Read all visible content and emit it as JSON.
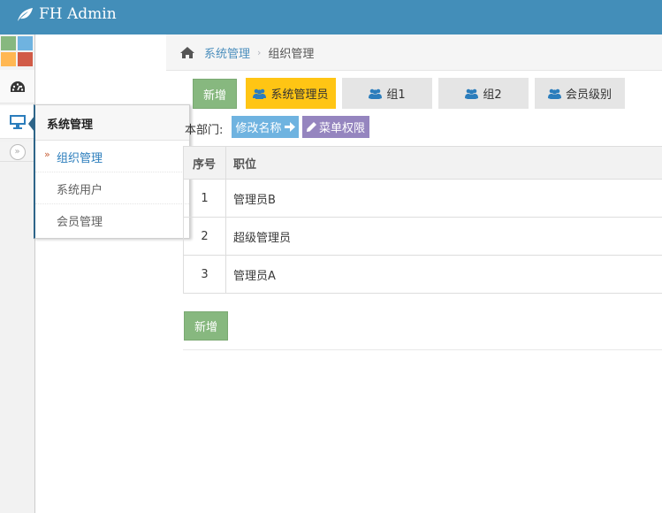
{
  "app": {
    "brand": "FH Admin"
  },
  "colors": {
    "navbar": "#438eb9",
    "accent": "#2b7dbc",
    "new_button": "#87b87f",
    "selected_group": "#ffc514",
    "rename_button": "#6fb3e0",
    "perm_button": "#9585bf"
  },
  "sidebar": {
    "shortcut_colors": [
      "#87b87f",
      "#6fb3e0",
      "#ffb752",
      "#d15b47"
    ],
    "icons": [
      "dashboard-icon",
      "desktop-icon",
      "collapse-icon"
    ]
  },
  "submenu": {
    "title": "系统管理",
    "items": [
      {
        "label": "组织管理",
        "current": true
      },
      {
        "label": "系统用户",
        "current": false
      },
      {
        "label": "会员管理",
        "current": false
      }
    ]
  },
  "breadcrumb": {
    "parent": "系统管理",
    "current": "组织管理"
  },
  "toolbar": {
    "new_label": "新增",
    "groups": [
      {
        "label": "系统管理员",
        "selected": true
      },
      {
        "label": "组1",
        "selected": false
      },
      {
        "label": "组2",
        "selected": false
      },
      {
        "label": "会员级别",
        "selected": false
      }
    ]
  },
  "dept": {
    "label": "本部门:",
    "rename_label": "修改名称",
    "perm_label": "菜单权限"
  },
  "table": {
    "headers": [
      "序号",
      "职位"
    ],
    "rows": [
      [
        "1",
        "管理员B"
      ],
      [
        "2",
        "超级管理员"
      ],
      [
        "3",
        "管理员A"
      ]
    ]
  },
  "footer": {
    "new_label": "新增"
  }
}
